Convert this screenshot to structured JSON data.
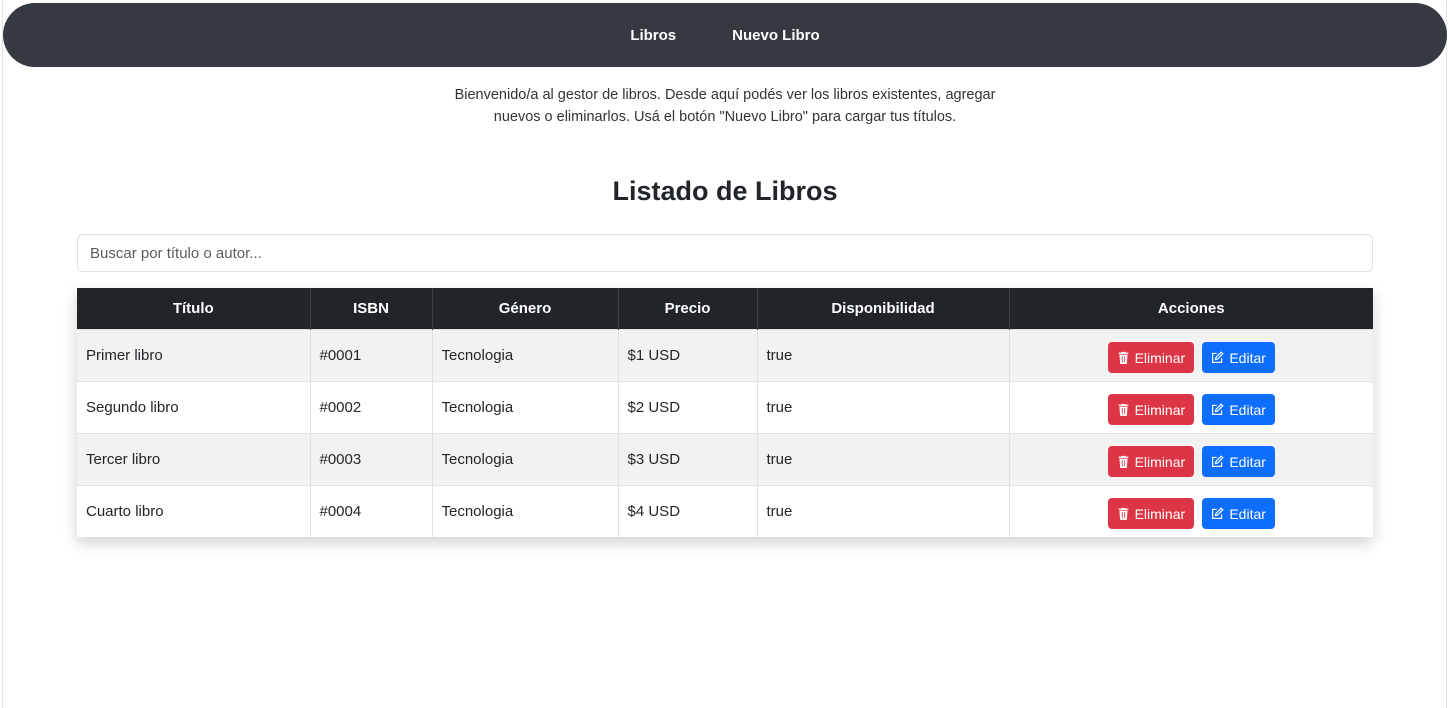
{
  "nav": {
    "items": [
      {
        "label": "Libros"
      },
      {
        "label": "Nuevo Libro"
      }
    ]
  },
  "intro_text": "Bienvenido/a al gestor de libros. Desde aquí podés ver los libros existentes, agregar nuevos o eliminarlos. Usá el botón \"Nuevo Libro\" para cargar tus títulos.",
  "title": "Listado de Libros",
  "search": {
    "placeholder": "Buscar por título o autor...",
    "value": ""
  },
  "table": {
    "headers": [
      "Título",
      "ISBN",
      "Género",
      "Precio",
      "Disponibilidad",
      "Acciones"
    ],
    "rows": [
      {
        "titulo": "Primer libro",
        "isbn": "#0001",
        "genero": "Tecnologia",
        "precio": "$1 USD",
        "disponibilidad": "true"
      },
      {
        "titulo": "Segundo libro",
        "isbn": "#0002",
        "genero": "Tecnologia",
        "precio": "$2 USD",
        "disponibilidad": "true"
      },
      {
        "titulo": "Tercer libro",
        "isbn": "#0003",
        "genero": "Tecnologia",
        "precio": "$3 USD",
        "disponibilidad": "true"
      },
      {
        "titulo": "Cuarto libro",
        "isbn": "#0004",
        "genero": "Tecnologia",
        "precio": "$4 USD",
        "disponibilidad": "true"
      }
    ],
    "delete_label": "Eliminar",
    "edit_label": "Editar",
    "delete_icon": "trash-icon",
    "edit_icon": "pencil-square-icon"
  },
  "colors": {
    "navbar": "#343a40",
    "table_header": "#212529",
    "danger": "#dc3545",
    "primary": "#0d6efd"
  }
}
